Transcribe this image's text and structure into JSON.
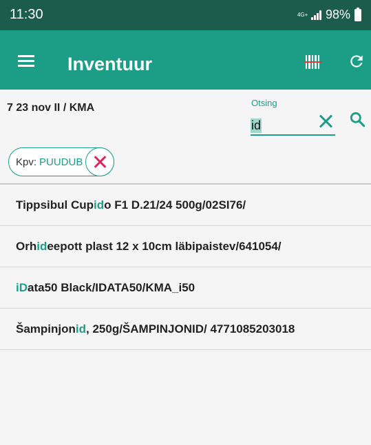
{
  "status_bar": {
    "time": "11:30",
    "network": "4G+",
    "battery": "98%"
  },
  "app_bar": {
    "title": "Inventuur"
  },
  "subtitle": "7 23 nov II  / KMA",
  "search": {
    "label": "Otsing",
    "value": "id"
  },
  "filter_chip": {
    "label": "Kpv:",
    "value": "PUUDUB"
  },
  "items": [
    {
      "before": "Tippsibul Cup",
      "match": "id",
      "after": "o F1 D.21/24 500g/02SI76/"
    },
    {
      "before": "Orh",
      "match": "id",
      "after": "eepott plast 12 x 10cm läbipaistev/641054/"
    },
    {
      "before": "",
      "match": "iD",
      "after": "ata50 Black/IDATA50/KMA_i50"
    },
    {
      "before": "Šampinjon",
      "match": "id",
      "after": ", 250g/ŠAMPINJONID/ 4771085203018"
    }
  ],
  "colors": {
    "primary": "#1b9d86",
    "status_bar": "#1b5c4c",
    "chip_remove": "#e0245e"
  },
  "icons": [
    "menu-icon",
    "barcode-icon",
    "refresh-icon",
    "clear-icon",
    "search-icon",
    "close-icon"
  ]
}
